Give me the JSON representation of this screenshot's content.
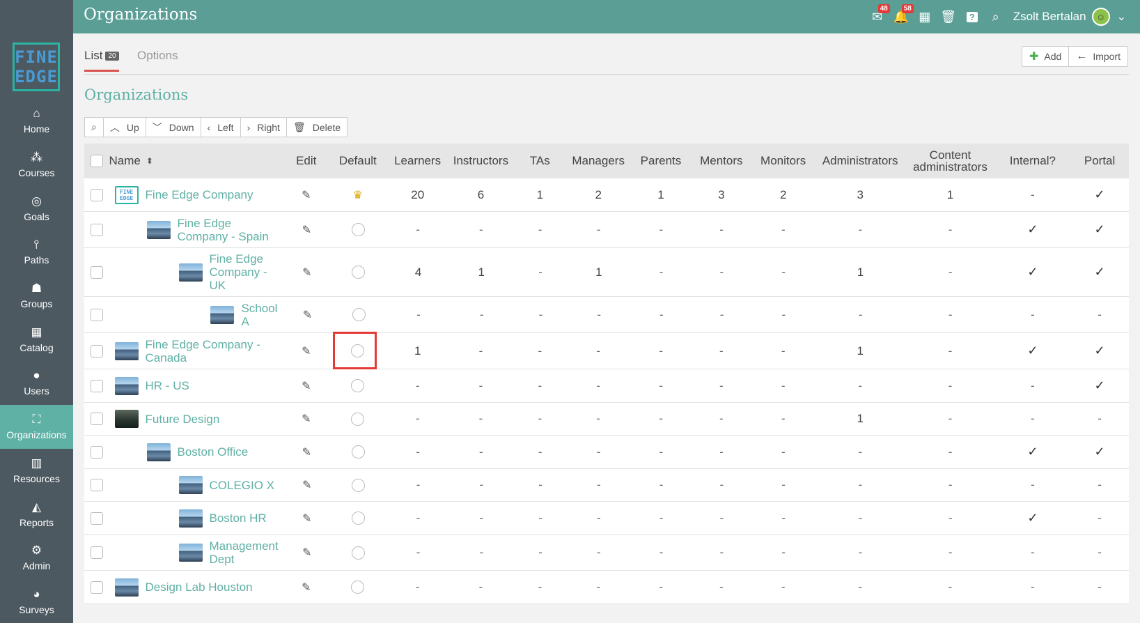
{
  "header": {
    "title": "Organizations",
    "messages_badge": "48",
    "notifications_badge": "58",
    "user_name": "Zsolt Bertalan"
  },
  "brand": {
    "line1": "FINE",
    "line2": "EDGE"
  },
  "nav": [
    {
      "label": "Home",
      "icon": "home-icon"
    },
    {
      "label": "Courses",
      "icon": "courses-icon"
    },
    {
      "label": "Goals",
      "icon": "goals-icon"
    },
    {
      "label": "Paths",
      "icon": "paths-icon"
    },
    {
      "label": "Groups",
      "icon": "groups-icon"
    },
    {
      "label": "Catalog",
      "icon": "catalog-icon"
    },
    {
      "label": "Users",
      "icon": "users-icon"
    },
    {
      "label": "Organizations",
      "icon": "organizations-icon",
      "active": true
    },
    {
      "label": "Resources",
      "icon": "resources-icon"
    },
    {
      "label": "Reports",
      "icon": "reports-icon"
    },
    {
      "label": "Admin",
      "icon": "admin-icon"
    },
    {
      "label": "Surveys",
      "icon": "surveys-icon"
    }
  ],
  "tabs": {
    "list_label": "List",
    "list_count": "20",
    "options_label": "Options"
  },
  "actions": {
    "add_label": "Add",
    "import_label": "Import"
  },
  "heading": "Organizations",
  "toolbar": {
    "up": "Up",
    "down": "Down",
    "left": "Left",
    "right": "Right",
    "delete": "Delete"
  },
  "columns": {
    "name": "Name",
    "edit": "Edit",
    "default": "Default",
    "learners": "Learners",
    "instructors": "Instructors",
    "tas": "TAs",
    "managers": "Managers",
    "parents": "Parents",
    "mentors": "Mentors",
    "monitors": "Monitors",
    "administrators": "Administrators",
    "content_admins_1": "Content",
    "content_admins_2": "administrators",
    "internal": "Internal?",
    "portal": "Portal"
  },
  "rows": [
    {
      "name": "Fine Edge Company",
      "indent": 0,
      "img": "logo",
      "default": "crown",
      "vals": [
        "20",
        "6",
        "1",
        "2",
        "1",
        "3",
        "2",
        "3",
        "1"
      ],
      "internal": "-",
      "portal": "✓",
      "height": 48
    },
    {
      "name": "Fine Edge Company - Spain",
      "indent": 1,
      "img": "photo",
      "default": "radio",
      "vals": [
        "-",
        "-",
        "-",
        "-",
        "-",
        "-",
        "-",
        "-",
        "-"
      ],
      "internal": "✓",
      "portal": "✓",
      "height": 52
    },
    {
      "name": "Fine Edge Company - UK",
      "indent": 2,
      "img": "photo",
      "default": "radio",
      "vals": [
        "4",
        "1",
        "-",
        "1",
        "-",
        "-",
        "-",
        "1",
        "-"
      ],
      "internal": "✓",
      "portal": "✓",
      "height": 70
    },
    {
      "name": "School A",
      "indent": 3,
      "img": "photo",
      "default": "radio",
      "vals": [
        "-",
        "-",
        "-",
        "-",
        "-",
        "-",
        "-",
        "-",
        "-"
      ],
      "internal": "-",
      "portal": "-",
      "height": 52
    },
    {
      "name": "Fine Edge Company - Canada",
      "indent": 0,
      "img": "photo",
      "default": "radio",
      "vals": [
        "1",
        "-",
        "-",
        "-",
        "-",
        "-",
        "-",
        "1",
        "-"
      ],
      "internal": "✓",
      "portal": "✓",
      "height": 52
    },
    {
      "name": "HR - US",
      "indent": 0,
      "img": "photo",
      "default": "radio",
      "vals": [
        "-",
        "-",
        "-",
        "-",
        "-",
        "-",
        "-",
        "-",
        "-"
      ],
      "internal": "-",
      "portal": "✓",
      "height": 48
    },
    {
      "name": "Future Design",
      "indent": 0,
      "img": "dark",
      "default": "radio",
      "vals": [
        "-",
        "-",
        "-",
        "-",
        "-",
        "-",
        "-",
        "1",
        "-"
      ],
      "internal": "-",
      "portal": "-",
      "height": 47
    },
    {
      "name": "Boston Office",
      "indent": 1,
      "img": "photo",
      "default": "radio",
      "vals": [
        "-",
        "-",
        "-",
        "-",
        "-",
        "-",
        "-",
        "-",
        "-"
      ],
      "internal": "✓",
      "portal": "✓",
      "height": 48
    },
    {
      "name": "COLEGIO X",
      "indent": 2,
      "img": "photo",
      "default": "radio",
      "vals": [
        "-",
        "-",
        "-",
        "-",
        "-",
        "-",
        "-",
        "-",
        "-"
      ],
      "internal": "-",
      "portal": "-",
      "height": 47
    },
    {
      "name": "Boston HR",
      "indent": 2,
      "img": "photo",
      "default": "radio",
      "vals": [
        "-",
        "-",
        "-",
        "-",
        "-",
        "-",
        "-",
        "-",
        "-"
      ],
      "internal": "✓",
      "portal": "-",
      "height": 48
    },
    {
      "name": "Management Dept",
      "indent": 2,
      "img": "photo",
      "default": "radio",
      "vals": [
        "-",
        "-",
        "-",
        "-",
        "-",
        "-",
        "-",
        "-",
        "-"
      ],
      "internal": "-",
      "portal": "-",
      "height": 51
    },
    {
      "name": "Design Lab Houston",
      "indent": 0,
      "img": "photo",
      "default": "radio",
      "vals": [
        "-",
        "-",
        "-",
        "-",
        "-",
        "-",
        "-",
        "-",
        "-"
      ],
      "internal": "-",
      "portal": "-",
      "height": 48
    }
  ]
}
